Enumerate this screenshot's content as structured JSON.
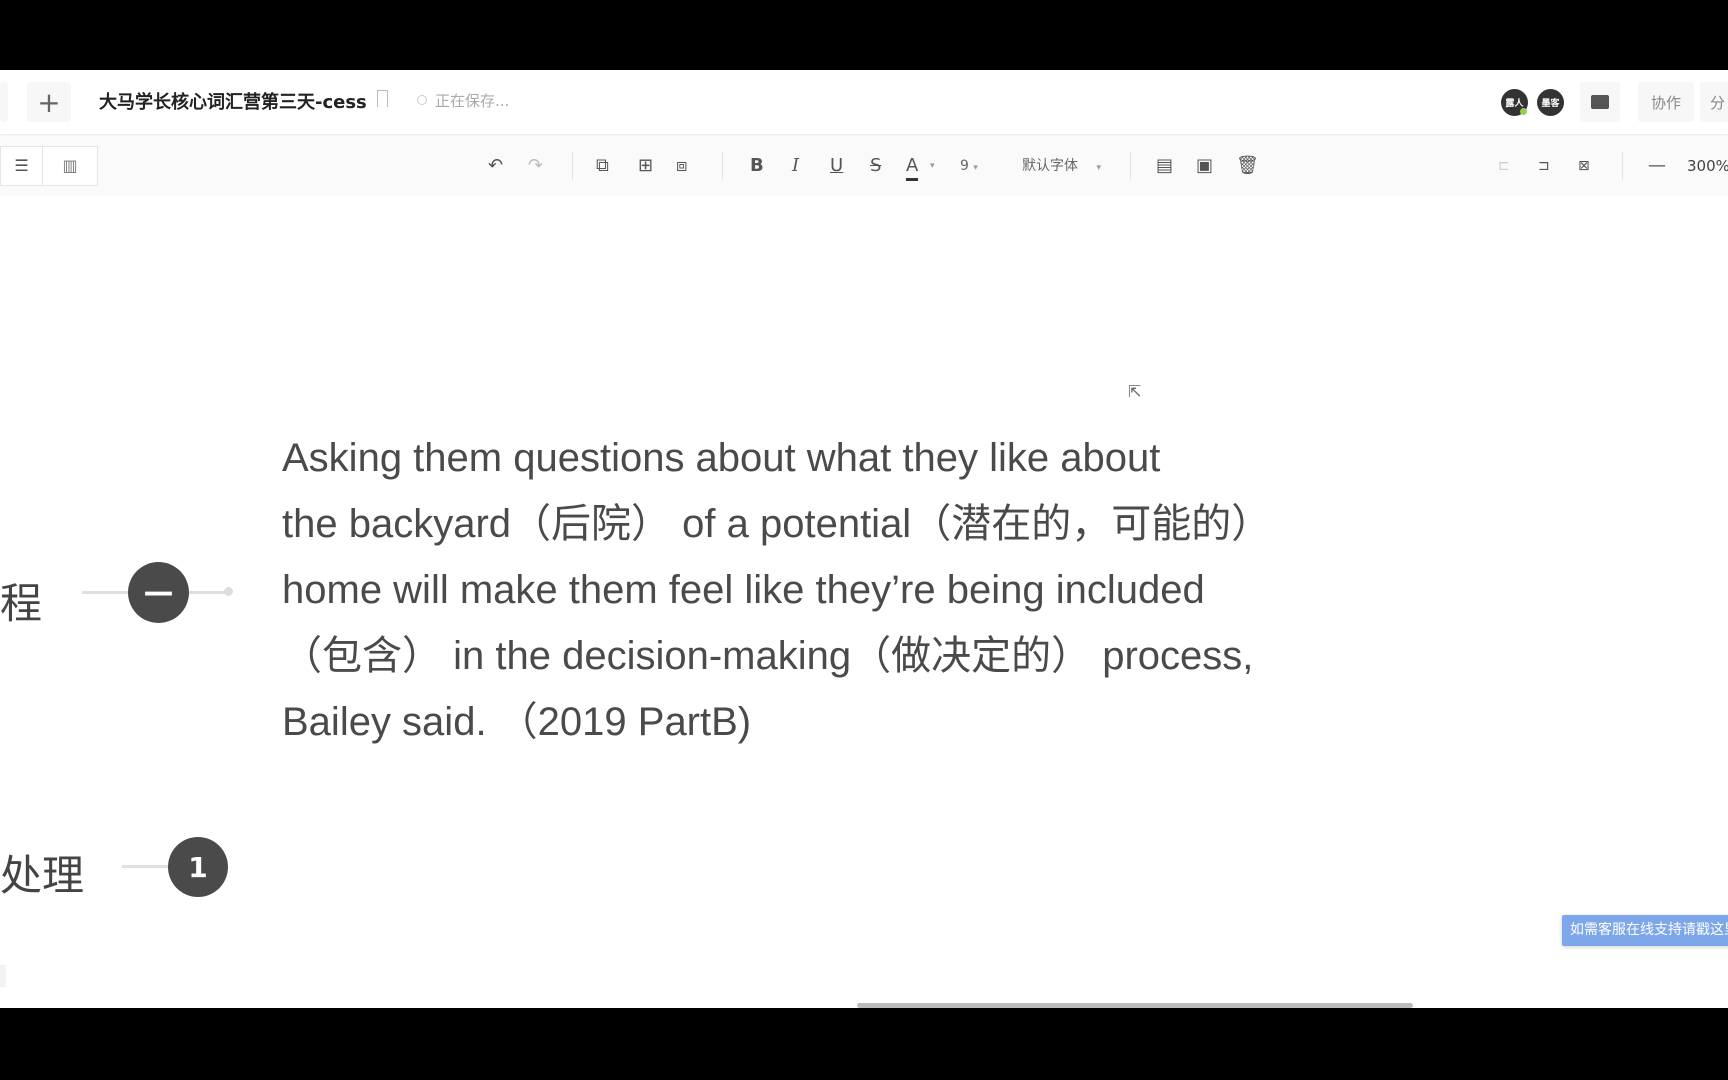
{
  "header": {
    "add_tab_icon": "plus-icon",
    "title": "大马学长核心词汇营第三天-cess",
    "bookmark_icon": "bookmark-icon",
    "status": "正在保存...",
    "avatars": [
      "露人",
      "墨客"
    ],
    "comment_icon": "comment-icon",
    "collaborate_label": "协作",
    "share_label": "分"
  },
  "toolbar": {
    "font_size": "9",
    "font_family": "默认字体",
    "zoom_level": "300%",
    "text_color": "#333333"
  },
  "canvas": {
    "content_lines": [
      "Asking them questions about what they like about",
      "the backyard（后院） of a potential（潜在的，可能的）",
      "home will make them feel like they’re being included",
      "（包含） in the decision-making（做决定的） process,",
      "Bailey said. （2019 PartB)"
    ],
    "node1_label": "程",
    "node1_collapse": "—",
    "node2_label": "处理",
    "node2_count": "1"
  },
  "support_banner": "如需客服在线支持请戳这里"
}
